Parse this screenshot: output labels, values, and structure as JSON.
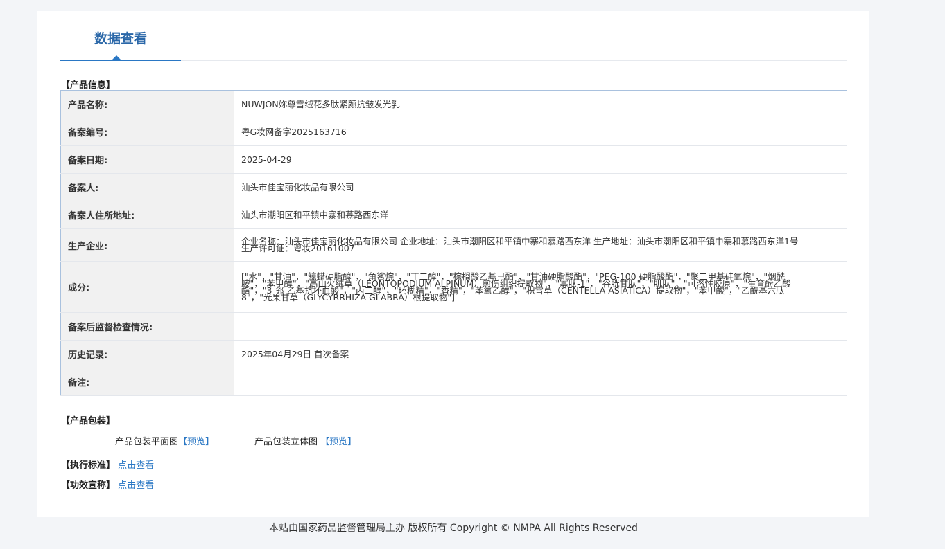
{
  "tab": {
    "label": "数据查看"
  },
  "product_info": {
    "section_title": "【产品信息】",
    "rows": [
      {
        "label": "产品名称:",
        "value": "NUWJON妳尊雪绒花多肽紧颜抗皱发光乳"
      },
      {
        "label": "备案编号:",
        "value": "粤G妆网备字2025163716"
      },
      {
        "label": "备案日期:",
        "value": "2025-04-29"
      },
      {
        "label": "备案人:",
        "value": "汕头市佳宝丽化妆品有限公司"
      },
      {
        "label": "备案人住所地址:",
        "value": "汕头市潮阳区和平镇中寨和慕路西东洋"
      },
      {
        "label": "生产企业:",
        "value": "企业名称：汕头市佳宝丽化妆品有限公司 企业地址：汕头市潮阳区和平镇中寨和慕路西东洋 生产地址：汕头市潮阳区和平镇中寨和慕路西东洋1号 生产许可证：粤妆20161007"
      },
      {
        "label": "成分:",
        "value": "[\"水\"，\"甘油\"，\"鲸蜡硬脂醇\"，\"角鲨烷\"，\"丁二醇\"，\"棕榈酸乙基己酯\"，\"甘油硬脂酸酯\"，\"PEG-100 硬脂酸酯\"，\"聚二甲基硅氧烷\"，\"烟酰胺\"，\"苯甲醇\"，\"高山火绒草（LEONTOPODIUM ALPINUM）愈伤组织提取物\"，\"寡肽-1\"，\"谷胱甘肽\"，\"肌肽\"，\"可溶性胶原\"，\"生育酚乙酸酯\"，\"3-邻-乙基抗坏血酸\"，\"丙二醇\"，\"环糊精\"，\"香精\"，\"苯氧乙醇\"，\"积雪草（CENTELLA ASIATICA）提取物\"，\"苯甲酸\"，\"乙酰基六肽-8\"，\"光果甘草（GLYCYRRHIZA GLABRA）根提取物\"]"
      },
      {
        "label": "备案后监督检查情况:",
        "value": ""
      },
      {
        "label": "历史记录:",
        "value": "2025年04月29日 首次备案"
      },
      {
        "label": "备注:",
        "value": ""
      }
    ]
  },
  "packaging": {
    "section_title": "【产品包装】",
    "flat_label": "产品包装平面图",
    "flat_link": "【预览】",
    "stereo_label": "产品包装立体图",
    "stereo_link": "【预览】"
  },
  "standard": {
    "label": "【执行标准】",
    "link": "点击查看"
  },
  "efficacy": {
    "label": "【功效宣称】",
    "link": "点击查看"
  },
  "footer": {
    "text": "本站由国家药品监督管理局主办 版权所有 Copyright © NMPA All Rights Reserved"
  }
}
